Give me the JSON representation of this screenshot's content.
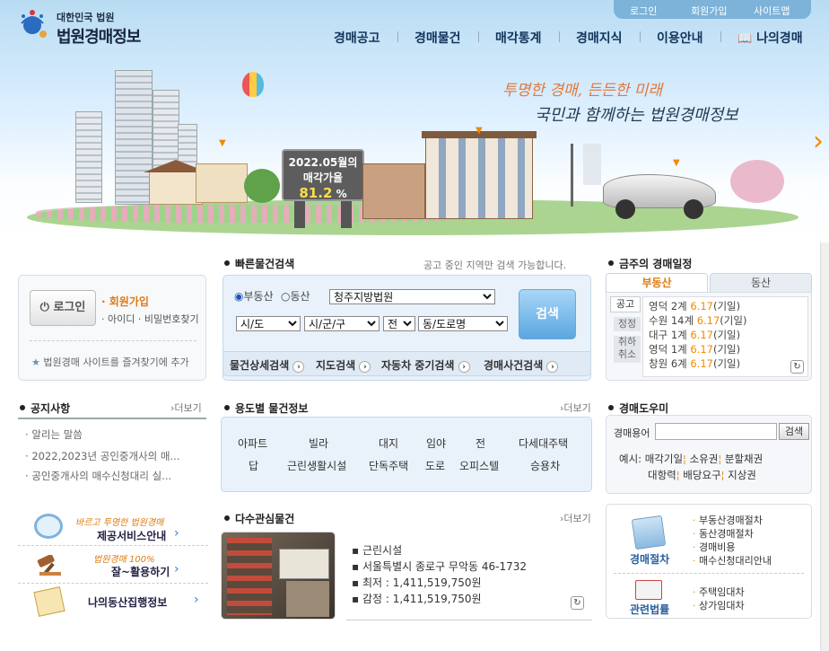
{
  "header": {
    "org": "대한민국 법원",
    "site": "법원경매정보",
    "util": [
      "로그인",
      "회원가입",
      "사이트맵"
    ],
    "gnb": [
      "경매공고",
      "경매물건",
      "매각통계",
      "경매지식",
      "이용안내",
      "나의경매"
    ]
  },
  "hero": {
    "slogan1": "투명한 경매, 든든한 미래",
    "slogan2": "국민과 함께하는 법원경매정보",
    "billboard": {
      "line1": "2022.05월의",
      "line2": "매각가율",
      "value": "81.2",
      "unit": "%"
    }
  },
  "login": {
    "button": "로그인",
    "join": "회원가입",
    "find": "아이디 · 비밀번호찾기",
    "favorite": "법원경매 사이트를 즐겨찾기에 추가"
  },
  "quick_search": {
    "title": "빠른물건검색",
    "note": "공고 중인 지역만 검색 가능합니다.",
    "radio1": "부동산",
    "radio2": "동산",
    "court": "청주지방법원",
    "sido": "시/도",
    "sigungu": "시/군/구",
    "dong_sel": "전",
    "road": "동/도로명",
    "search_btn": "검색",
    "links": [
      "물건상세검색",
      "지도검색",
      "자동차 중기검색",
      "경매사건검색"
    ]
  },
  "schedule": {
    "title": "금주의 경매일정",
    "tabs": [
      "부동산",
      "동산"
    ],
    "left_tabs": [
      "공고",
      "정정",
      "취하\n취소"
    ],
    "rows": [
      {
        "court": "영덕 2계",
        "date": "6.17",
        "type": "(기일)"
      },
      {
        "court": "수원 14계",
        "date": "6.17",
        "type": "(기일)"
      },
      {
        "court": "대구 1계",
        "date": "6.17",
        "type": "(기일)"
      },
      {
        "court": "영덕 1계",
        "date": "6.17",
        "type": "(기일)"
      },
      {
        "court": "창원 6계",
        "date": "6.17",
        "type": "(기일)"
      }
    ]
  },
  "notice": {
    "title": "공지사항",
    "more": "더보기",
    "items": [
      "알리는 말씀",
      "2022,2023년 공인중개사의 매...",
      "공인중개사의 매수신청대리 실..."
    ]
  },
  "usage": {
    "title": "용도별 물건정보",
    "more": "더보기",
    "row1": [
      "아파트",
      "빌라",
      "대지",
      "임야",
      "전",
      "다세대주택"
    ],
    "row2": [
      "답",
      "근린생활시설",
      "단독주택",
      "도로",
      "오피스텔",
      "승용차"
    ]
  },
  "help": {
    "title": "경매도우미",
    "term_label": "경매용어",
    "search": "검색",
    "example_label": "예시:",
    "terms1": [
      "매각기일",
      "소유권",
      "분할채권"
    ],
    "terms2": [
      "대항력",
      "배당요구",
      "지상권"
    ]
  },
  "services": [
    {
      "sub": "바르고 투명한 법원경매",
      "label": "제공서비스안내"
    },
    {
      "sub": "법원경매 100%",
      "label": "잘~활용하기"
    },
    {
      "sub": "",
      "label": "나의동산집행정보"
    }
  ],
  "interest": {
    "title": "다수관심물건",
    "more": "더보기",
    "items": [
      "근린시설",
      "서울특별시 종로구 무악동 46-1732",
      "최저 : 1,411,519,750원",
      "감정 : 1,411,519,750원"
    ]
  },
  "procedure": {
    "block1": {
      "title": "경매절차",
      "items": [
        "부동산경매절차",
        "동산경매절차",
        "경매비용",
        "매수신청대리안내"
      ]
    },
    "block2": {
      "title": "관련법률",
      "items": [
        "주택임대차",
        "상가임대차"
      ]
    }
  }
}
